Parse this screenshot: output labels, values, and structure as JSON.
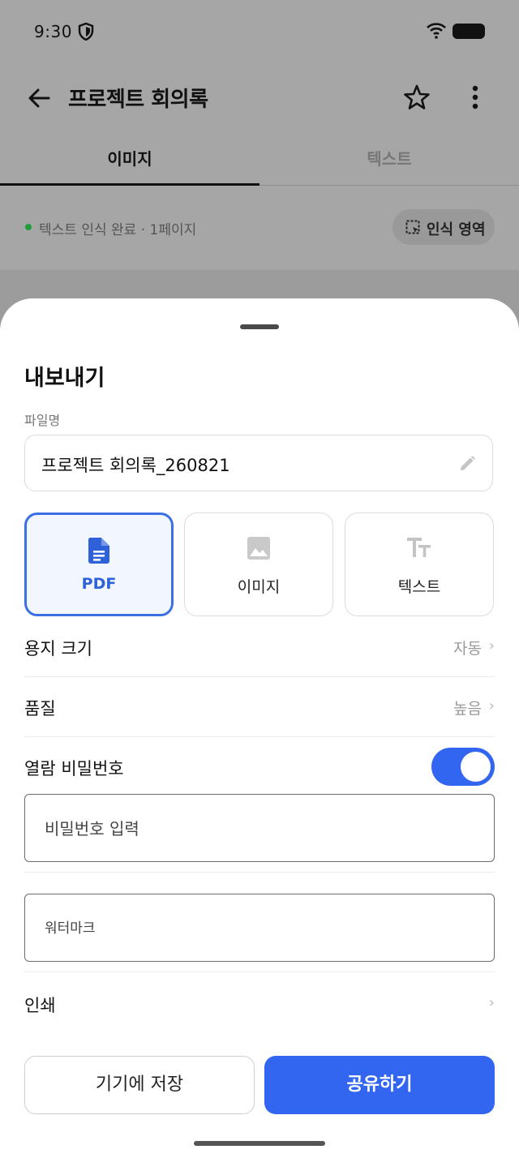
{
  "status_bar": {
    "time": "9:30"
  },
  "app_bar": {
    "title": "프로젝트 회의록"
  },
  "tabs": [
    {
      "label": "이미지",
      "active": true
    },
    {
      "label": "텍스트",
      "active": false
    }
  ],
  "ocr": {
    "status": "텍스트 인식 완료 · 1페이지",
    "region_button": "인식 영역"
  },
  "sheet": {
    "title": "내보내기",
    "filename_label": "파일명",
    "filename_value": "프로젝트 회의록_260821",
    "formats": [
      {
        "label": "PDF",
        "icon": "file-document-icon",
        "selected": true
      },
      {
        "label": "이미지",
        "icon": "image-icon",
        "selected": false
      },
      {
        "label": "텍스트",
        "icon": "text-format-icon",
        "selected": false
      }
    ],
    "paper_size": {
      "label": "용지 크기",
      "value": "자동"
    },
    "quality": {
      "label": "품질",
      "value": "높음"
    },
    "password": {
      "label": "열람 비밀번호",
      "enabled": true,
      "placeholder": "비밀번호 입력"
    },
    "watermark": {
      "placeholder": "워터마크"
    },
    "print": {
      "label": "인쇄"
    },
    "buttons": {
      "save": "기기에 저장",
      "share": "공유하기"
    }
  },
  "colors": {
    "accent": "#3366f0",
    "selected_border": "#3b6fe4",
    "status_ok": "#1f9d3a"
  }
}
